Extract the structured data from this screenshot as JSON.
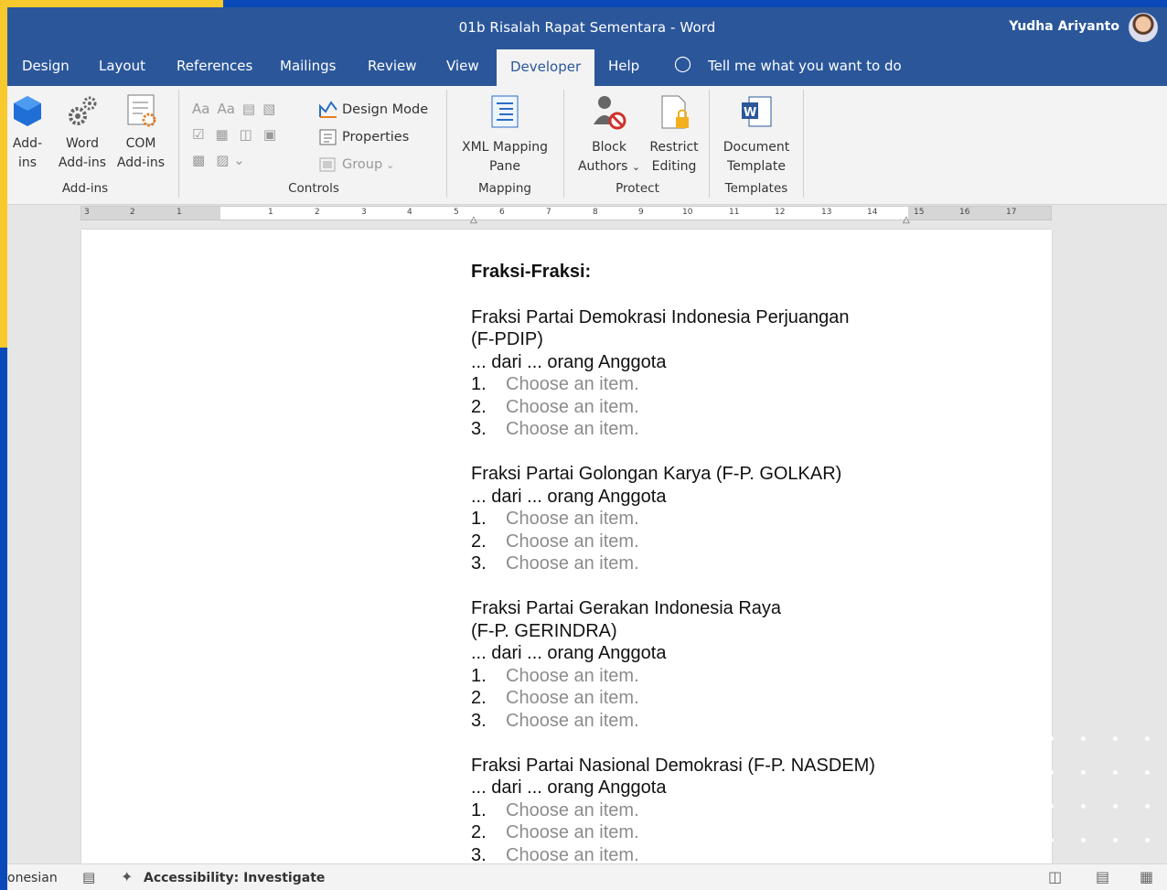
{
  "app": {
    "title": "01b Risalah Rapat Sementara  -  Word",
    "user": "Yudha Ariyanto"
  },
  "tabs": [
    {
      "label": "Design"
    },
    {
      "label": "Layout"
    },
    {
      "label": "References"
    },
    {
      "label": "Mailings"
    },
    {
      "label": "Review"
    },
    {
      "label": "View"
    },
    {
      "label": "Developer",
      "active": true
    },
    {
      "label": "Help"
    }
  ],
  "tell_me": "Tell me what you want to do",
  "ribbon": {
    "addins": {
      "label": "Add-ins",
      "add_ins_1": "Add-",
      "add_ins_2": "ins",
      "word_1": "Word",
      "word_2": "Add-ins",
      "com_1": "COM",
      "com_2": "Add-ins"
    },
    "controls": {
      "label": "Controls",
      "design_mode": "Design Mode",
      "properties": "Properties",
      "group": "Group"
    },
    "mapping": {
      "label": "Mapping",
      "xml_1": "XML Mapping",
      "xml_2": "Pane"
    },
    "protect": {
      "label": "Protect",
      "block_1": "Block",
      "block_2": "Authors",
      "restrict_1": "Restrict",
      "restrict_2": "Editing"
    },
    "templates": {
      "label": "Templates",
      "doc_1": "Document",
      "doc_2": "Template"
    }
  },
  "ruler": {
    "left_ticks": [
      "3",
      "2",
      "1"
    ],
    "ticks": [
      "1",
      "2",
      "3",
      "4",
      "5",
      "6",
      "7",
      "8",
      "9",
      "10",
      "11",
      "12",
      "13",
      "14",
      "15",
      "16",
      "17"
    ]
  },
  "document": {
    "heading": "Fraksi-Fraksi:",
    "member_line": "... dari ... orang Anggota",
    "placeholder": "Choose an item.",
    "factions": [
      {
        "line1": "Fraksi Partai Demokrasi Indonesia Perjuangan",
        "line2": "(F-PDIP)"
      },
      {
        "line1": "Fraksi Partai Golongan Karya (F-P. GOLKAR)",
        "line2": ""
      },
      {
        "line1": "Fraksi Partai Gerakan Indonesia Raya",
        "line2": "(F-P. GERINDRA)"
      },
      {
        "line1": "Fraksi Partai Nasional Demokrasi (F-P. NASDEM)",
        "line2": ""
      }
    ],
    "numbers": [
      "1.",
      "2.",
      "3."
    ]
  },
  "status": {
    "language": "onesian",
    "accessibility": "Accessibility: Investigate"
  },
  "colors": {
    "accent": "#2b579a",
    "frame_blue": "#0a4ab8",
    "frame_yellow": "#f8c92c"
  }
}
